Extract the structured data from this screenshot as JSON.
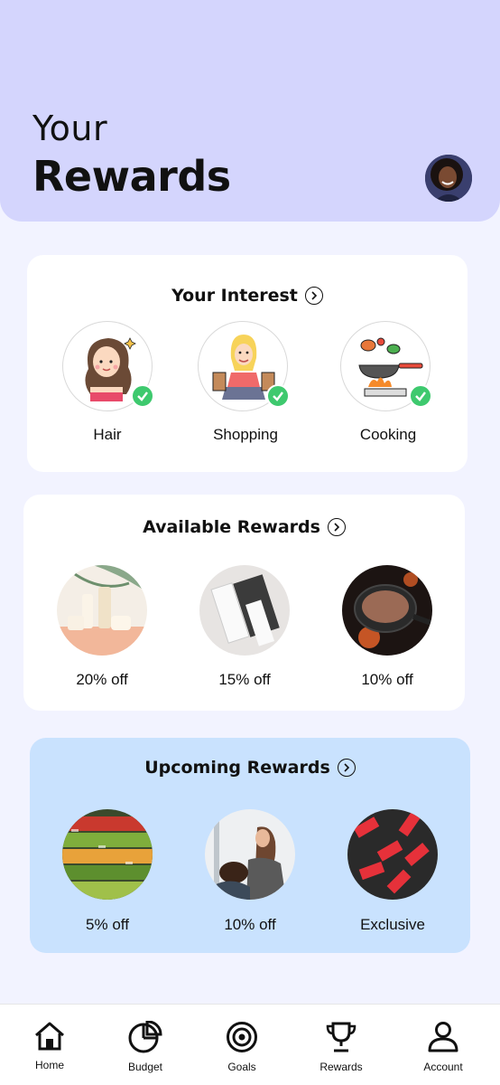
{
  "header": {
    "subtitle": "Your",
    "title": "Rewards",
    "avatar_icon": "user-avatar"
  },
  "interest": {
    "title": "Your Interest",
    "items": [
      {
        "label": "Hair",
        "icon": "hair-illustration",
        "selected": true
      },
      {
        "label": "Shopping",
        "icon": "shopping-illustration",
        "selected": true
      },
      {
        "label": "Cooking",
        "icon": "cooking-illustration",
        "selected": true
      }
    ]
  },
  "available": {
    "title": "Available Rewards",
    "items": [
      {
        "label": "20% off",
        "icon": "skincare-photo"
      },
      {
        "label": "15% off",
        "icon": "cosmetic-tube-photo"
      },
      {
        "label": "10% off",
        "icon": "frying-pan-photo"
      }
    ]
  },
  "upcoming": {
    "title": "Upcoming Rewards",
    "items": [
      {
        "label": "5% off",
        "icon": "grocery-produce-photo"
      },
      {
        "label": "10% off",
        "icon": "hair-salon-photo"
      },
      {
        "label": "Exclusive",
        "icon": "sale-tags-photo"
      }
    ]
  },
  "nav": {
    "items": [
      {
        "label": "Home",
        "icon": "home-icon"
      },
      {
        "label": "Budget",
        "icon": "pie-chart-icon"
      },
      {
        "label": "Goals",
        "icon": "target-icon"
      },
      {
        "label": "Rewards",
        "icon": "trophy-icon"
      },
      {
        "label": "Account",
        "icon": "user-icon"
      }
    ]
  },
  "colors": {
    "header_bg": "#d4d5fd",
    "page_bg": "#f2f3ff",
    "upcoming_bg": "#c9e2fe",
    "check_green": "#3ec96e"
  }
}
